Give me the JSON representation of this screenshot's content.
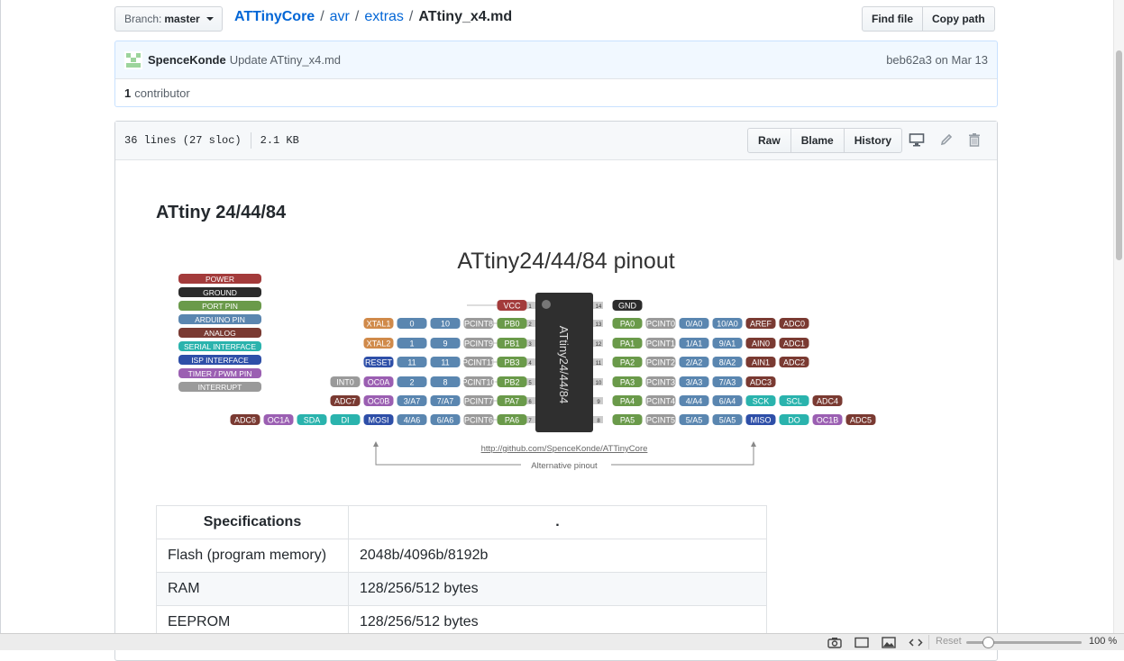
{
  "branch": {
    "prefix": "Branch:",
    "name": "master"
  },
  "breadcrumb": {
    "repo": "ATTinyCore",
    "dir1": "avr",
    "dir2": "extras",
    "file": "ATtiny_x4.md"
  },
  "file_actions": {
    "find_file": "Find file",
    "copy_path": "Copy path"
  },
  "commit": {
    "author": "SpenceKonde",
    "message": "Update ATtiny_x4.md",
    "sha": "beb62a3",
    "date_prefix": "on",
    "date": "Mar 13"
  },
  "contributors": {
    "count": "1",
    "label": "contributor"
  },
  "file_info": {
    "lines": "36 lines (27 sloc)",
    "size": "2.1 KB"
  },
  "file_buttons": {
    "raw": "Raw",
    "blame": "Blame",
    "history": "History"
  },
  "icons": {
    "desktop": "desktop-icon",
    "edit": "pencil-icon",
    "delete": "trash-icon"
  },
  "markdown": {
    "heading": "ATtiny 24/44/84"
  },
  "pinout": {
    "title": "ATtiny24/44/84 pinout",
    "chip_label": "ATtiny24/44/84",
    "url": "http://github.com/SpenceKonde/ATTinyCore",
    "alt_label": "Alternative pinout",
    "legend": [
      "POWER",
      "GROUND",
      "PORT PIN",
      "ARDUINO PIN",
      "ANALOG",
      "SERIAL INTERFACE",
      "ISP INTERFACE",
      "TIMER / PWM PIN",
      "INTERRUPT"
    ],
    "left_rows": [
      [
        "VCC"
      ],
      [
        "XTAL1",
        "0",
        "10",
        "PCINT8",
        "PB0"
      ],
      [
        "XTAL2",
        "1",
        "9",
        "PCINT9",
        "PB1"
      ],
      [
        "RESET",
        "11",
        "11",
        "PCINT11",
        "PB3"
      ],
      [
        "INT0",
        "OC0A",
        "2",
        "8",
        "PCINT10",
        "PB2"
      ],
      [
        "ADC7",
        "OC0B",
        "3/A7",
        "7/A7",
        "PCINT7",
        "PA7"
      ],
      [
        "ADC6",
        "OC1A",
        "SDA",
        "DI",
        "MOSI",
        "4/A6",
        "6/A6",
        "PCINT6",
        "PA6"
      ]
    ],
    "right_rows": [
      [
        "GND"
      ],
      [
        "PA0",
        "PCINT0",
        "0/A0",
        "10/A0",
        "AREF",
        "ADC0"
      ],
      [
        "PA1",
        "PCINT1",
        "1/A1",
        "9/A1",
        "AIN0",
        "ADC1"
      ],
      [
        "PA2",
        "PCINT2",
        "2/A2",
        "8/A2",
        "AIN1",
        "ADC2"
      ],
      [
        "PA3",
        "PCINT3",
        "3/A3",
        "7/A3",
        "ADC3"
      ],
      [
        "PA4",
        "PCINT4",
        "4/A4",
        "6/A4",
        "SCK",
        "SCL",
        "ADC4"
      ],
      [
        "PA5",
        "PCINT5",
        "5/A5",
        "5/A5",
        "MISO",
        "DO",
        "OC1B",
        "ADC5"
      ]
    ],
    "left_numbers": [
      "1",
      "2",
      "3",
      "4",
      "5",
      "6",
      "7"
    ],
    "right_numbers": [
      "14",
      "13",
      "12",
      "11",
      "10",
      "9",
      "8"
    ],
    "colors": {
      "POWER": "#a33b3b",
      "GROUND": "#2b2b2b",
      "PORT PIN": "#6a9a4a",
      "ARDUINO PIN": "#5a86b0",
      "ANALOG": "#7a3a32",
      "SERIAL INTERFACE": "#2ab3ad",
      "ISP INTERFACE": "#2e4fa8",
      "TIMER / PWM PIN": "#9b5fb2",
      "INTERRUPT": "#9a9a9a",
      "XTAL": "#d08a4a"
    }
  },
  "spec_table": {
    "headers": [
      "Specifications",
      "."
    ],
    "rows": [
      [
        "Flash (program memory)",
        "2048b/4096b/8192b"
      ],
      [
        "RAM",
        "128/256/512 bytes"
      ],
      [
        "EEPROM",
        "128/256/512 bytes"
      ]
    ]
  },
  "statusbar": {
    "reset": "Reset",
    "zoom": "100 %"
  }
}
